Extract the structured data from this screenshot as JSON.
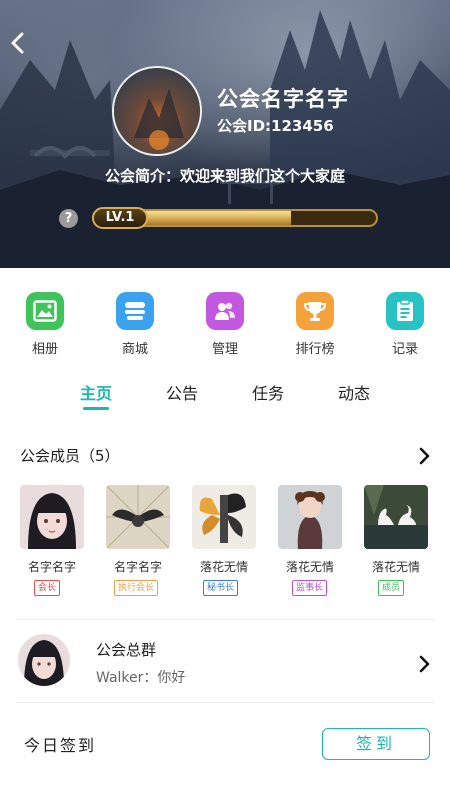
{
  "header": {
    "guild_name": "公会名字名字",
    "guild_id": "公会ID:123456",
    "intro": "公会简介：欢迎来到我们这个大家庭",
    "level": "LV.1",
    "level_progress": 0.7
  },
  "menu": {
    "items": [
      {
        "label": "相册",
        "icon": "photo-album-icon",
        "color": "#3fc35a"
      },
      {
        "label": "商城",
        "icon": "shop-icon",
        "color": "#3aa2ef"
      },
      {
        "label": "管理",
        "icon": "manage-users-icon",
        "color": "#c257e0"
      },
      {
        "label": "排行榜",
        "icon": "trophy-icon",
        "color": "#f5a23a"
      },
      {
        "label": "记录",
        "icon": "clipboard-icon",
        "color": "#26c2c4"
      }
    ]
  },
  "tabs": [
    {
      "label": "主页",
      "active": true
    },
    {
      "label": "公告",
      "active": false
    },
    {
      "label": "任务",
      "active": false
    },
    {
      "label": "动态",
      "active": false
    }
  ],
  "members": {
    "title": "公会成员（5）",
    "list": [
      {
        "name": "名字名字",
        "role": "会长",
        "role_color": "#e84b4b"
      },
      {
        "name": "名字名字",
        "role": "执行会长",
        "role_color": "#f0a04a"
      },
      {
        "name": "落花无情",
        "role": "秘书长",
        "role_color": "#3a7fd6"
      },
      {
        "name": "落花无情",
        "role": "监事长",
        "role_color": "#c14fd6"
      },
      {
        "name": "落花无情",
        "role": "成员",
        "role_color": "#3fbf5a"
      }
    ]
  },
  "group": {
    "name": "公会总群",
    "last_message": "Walker：你好"
  },
  "signin": {
    "label": "今日签到",
    "button": "签到"
  },
  "colors": {
    "accent": "#1cb7b1"
  }
}
